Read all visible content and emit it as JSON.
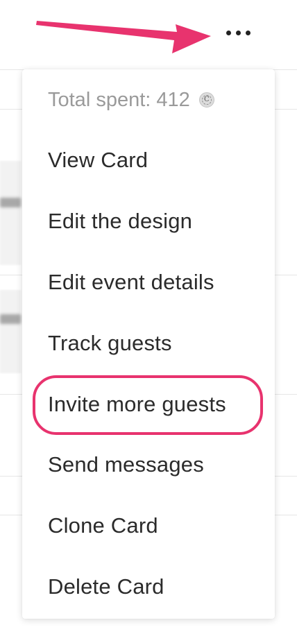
{
  "more_button": {
    "icon": "more-horizontal-icon"
  },
  "menu": {
    "total_spent_label": "Total spent: 412",
    "coin_icon": "coin-icon",
    "items": [
      {
        "label": "View Card"
      },
      {
        "label": "Edit the design"
      },
      {
        "label": "Edit event details"
      },
      {
        "label": "Track guests"
      },
      {
        "label": "Invite more guests"
      },
      {
        "label": "Send messages"
      },
      {
        "label": "Clone Card"
      },
      {
        "label": "Delete Card"
      }
    ]
  },
  "annotation": {
    "color": "#e8336e",
    "highlighted_item": "Invite more guests"
  }
}
